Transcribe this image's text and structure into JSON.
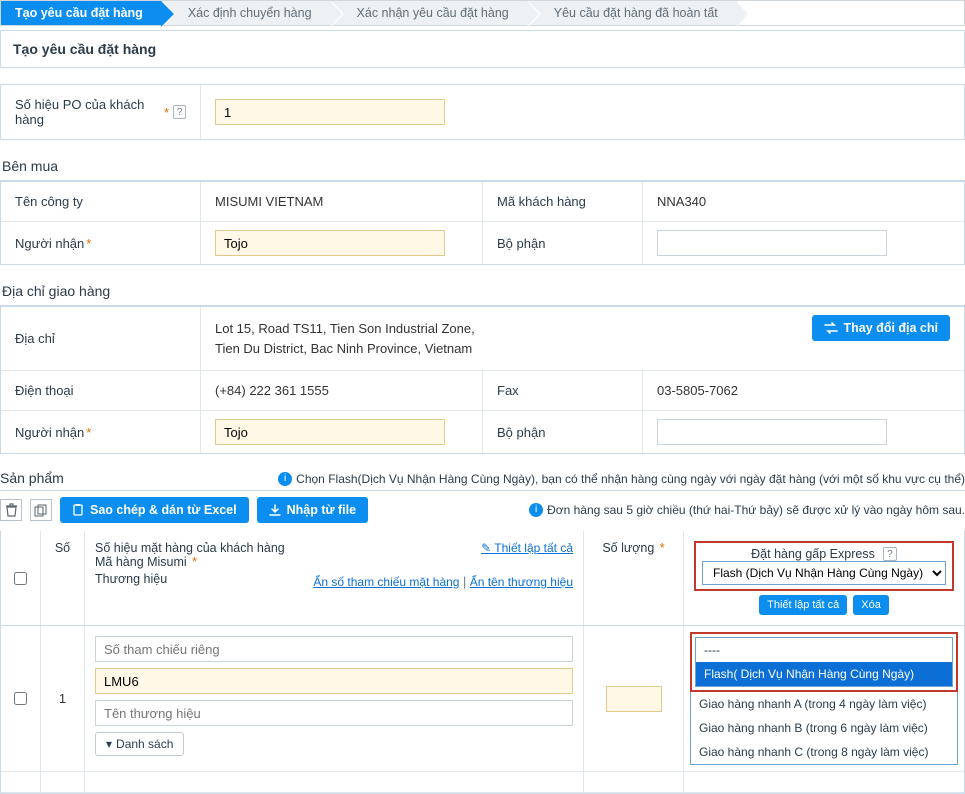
{
  "stepper": {
    "s1": "Tạo yêu cầu đặt hàng",
    "s2": "Xác định chuyển hàng",
    "s3": "Xác nhận yêu cầu đặt hàng",
    "s4": "Yêu cầu đặt hàng đã hoàn tất"
  },
  "page_title": "Tạo yêu cầu đặt hàng",
  "po": {
    "label": "Số hiệu PO của khách hàng",
    "value": "1"
  },
  "buyer": {
    "heading": "Bên mua",
    "company_lbl": "Tên công ty",
    "company_val": "MISUMI VIETNAM",
    "custcode_lbl": "Mã khách hàng",
    "custcode_val": "NNA340",
    "recipient_lbl": "Người nhận",
    "recipient_val": "Tojo",
    "dept_lbl": "Bộ phận",
    "dept_val": ""
  },
  "ship": {
    "heading": "Địa chỉ giao hàng",
    "addr_lbl": "Địa chỉ",
    "addr_line1": "Lot 15, Road TS11, Tien Son Industrial Zone,",
    "addr_line2": "Tien Du District, Bac Ninh Province, Vietnam",
    "change_btn": "Thay đổi địa chỉ",
    "phone_lbl": "Điện thoại",
    "phone_val": "(+84) 222 361 1555",
    "fax_lbl": "Fax",
    "fax_val": "03-5805-7062",
    "recipient_lbl": "Người nhận",
    "recipient_val": "Tojo",
    "dept_lbl": "Bộ phận",
    "dept_val": ""
  },
  "products": {
    "heading": "Sản phẩm",
    "info1": "Chọn Flash(Dịch Vụ Nhận Hàng Cùng Ngày), bạn có thể nhận hàng cùng ngày với ngày đặt hàng (với một số khu vực cụ thể)",
    "info2": "Đơn hàng sau 5 giờ chiều (thứ hai-Thứ bảy) sẽ được xử lý vào ngày hôm sau.",
    "copy_btn": "Sao chép & dán từ Excel",
    "import_btn": "Nhập từ file",
    "col_no": "Số",
    "col_ref_l1": "Số hiệu mặt hàng của khách hàng",
    "col_ref_l2": "Mã hàng Misumi",
    "col_ref_l3": "Thương hiệu",
    "set_all": "Thiết lập tất cả",
    "hide_ref": "Ẩn số tham chiếu mặt hàng",
    "hide_brand": "Ẩn tên thương hiệu",
    "col_qty": "Số lượng",
    "col_exp_title": "Đặt hàng gấp Express",
    "exp_select_value": "Flash (Dịch Vụ Nhận Hàng Cùng Ngày)",
    "pill_setall": "Thiết lập tất cả",
    "pill_clear": "Xóa",
    "item": {
      "no": "1",
      "ref_ph": "Số tham chiếu riêng",
      "part": "LMU6",
      "brand_ph": "Tên thương hiệu",
      "list_btn": "Danh sách",
      "qty_val": ""
    },
    "dropdown": {
      "opt0": "----",
      "opt1": "Flash( Dịch Vụ Nhận Hàng Cùng Ngày)",
      "opt2": "Giao hàng nhanh A (trong 4 ngày làm việc)",
      "opt3": "Giao hàng nhanh B (trong 6 ngày làm việc)",
      "opt4": "Giao hàng nhanh C (trong 8 ngày làm việc)"
    }
  }
}
